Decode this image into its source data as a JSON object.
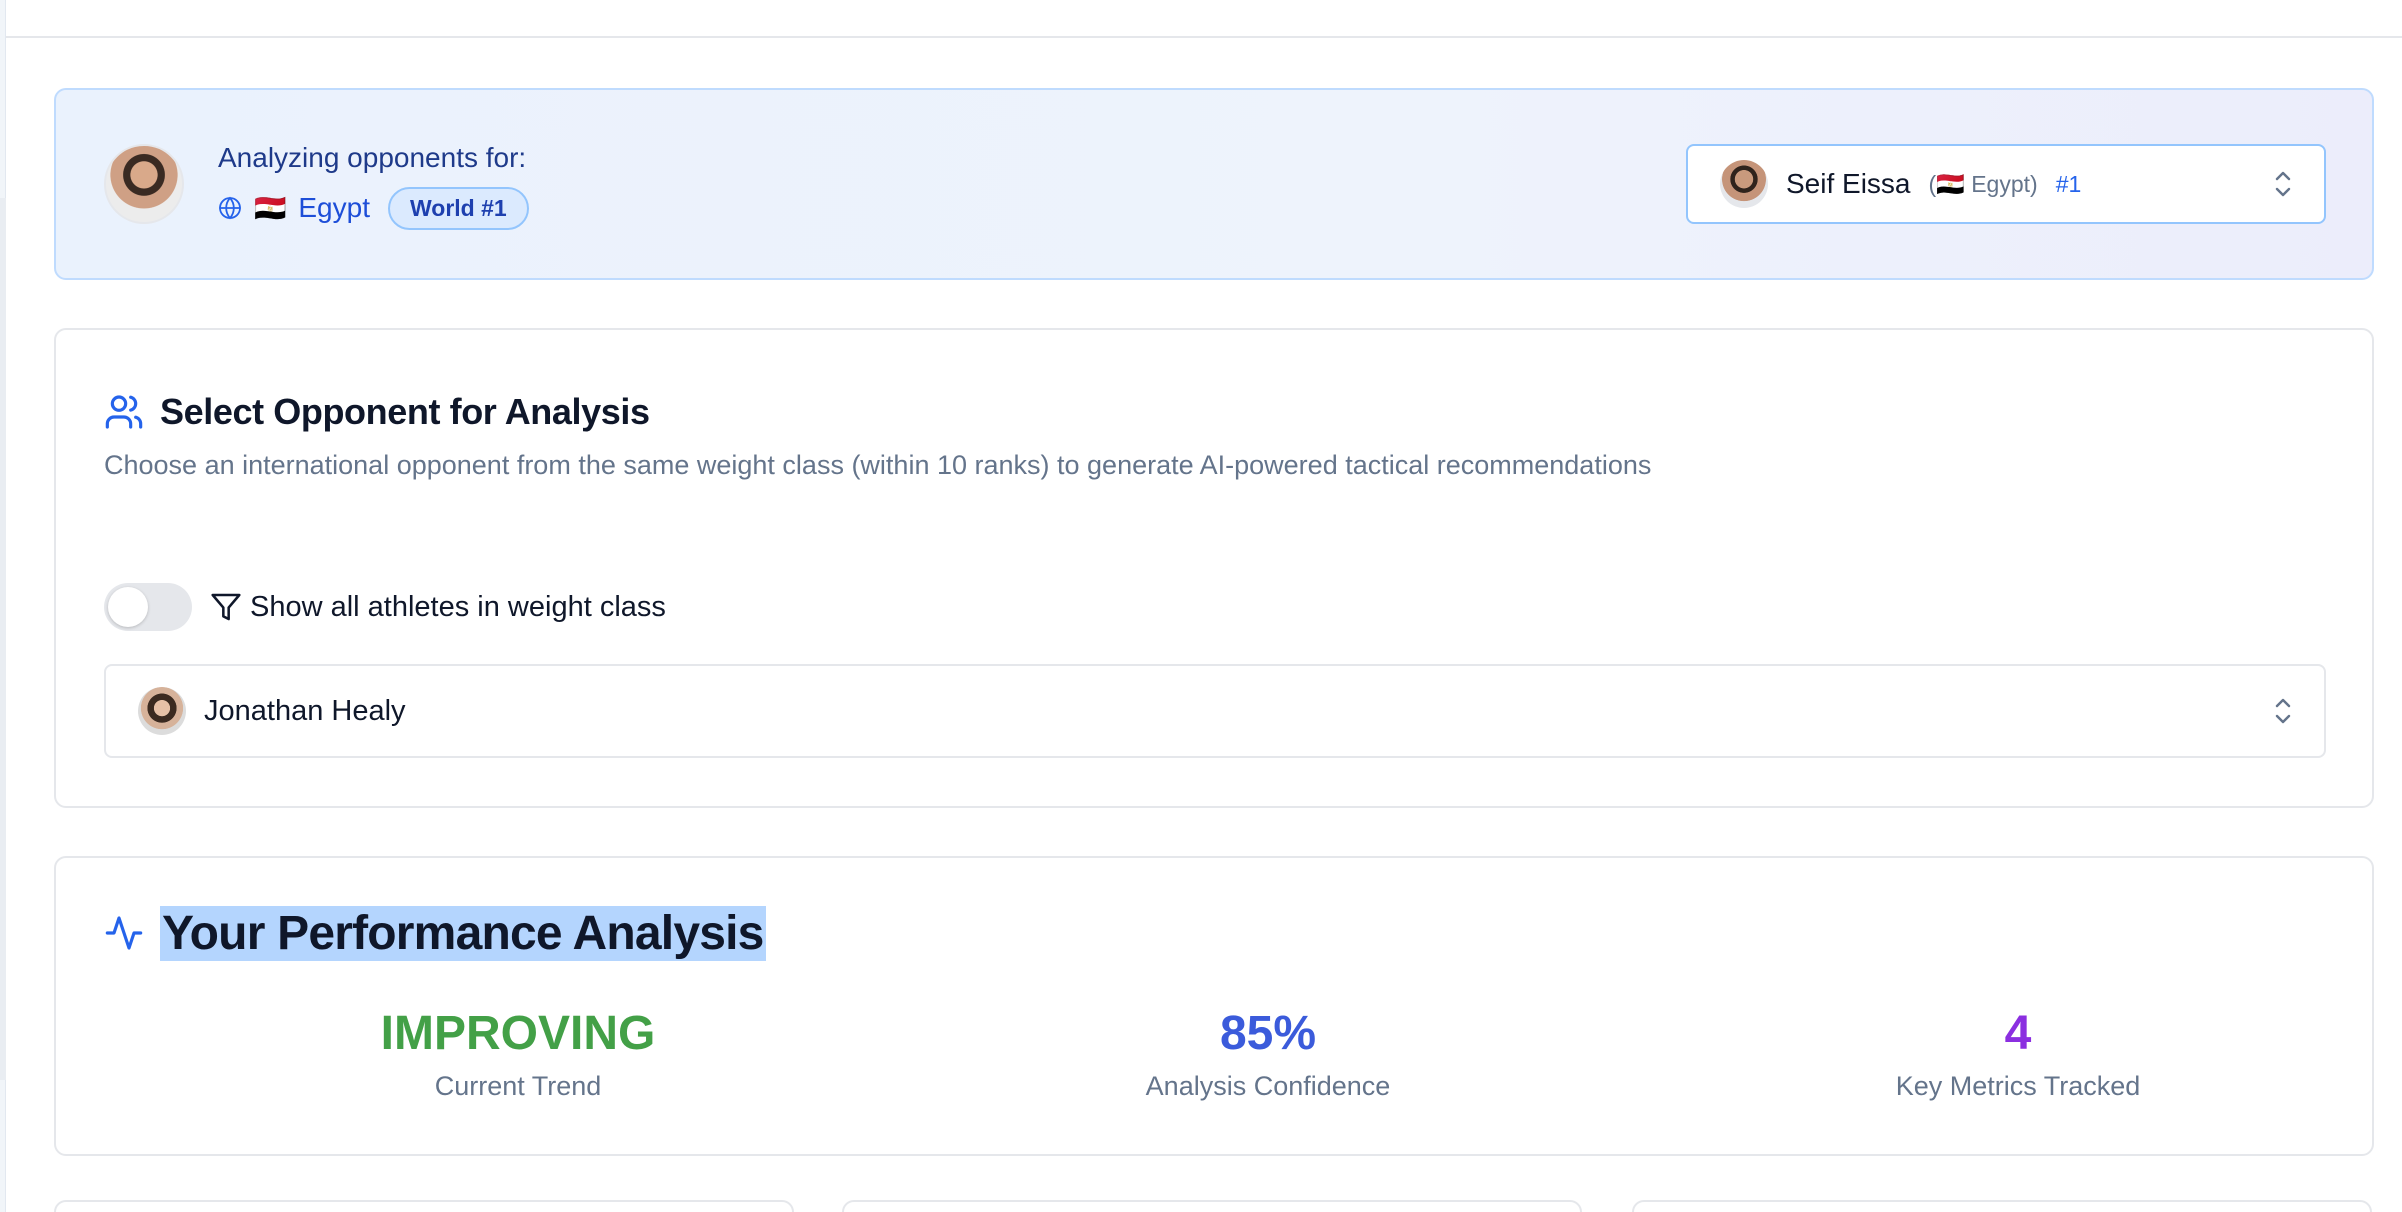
{
  "banner": {
    "label": "Analyzing opponents for:",
    "country_flag": "🇪🇬",
    "country": "Egypt",
    "world_rank_badge": "World #1",
    "selector": {
      "name": "Seif Eissa",
      "country_open": "(",
      "country_flag": "🇪🇬",
      "country": "Egypt",
      "country_close": ")",
      "rank": "#1"
    }
  },
  "opponent_card": {
    "title": "Select Opponent for Analysis",
    "description": "Choose an international opponent from the same weight class (within 10 ranks) to generate AI-powered tactical recommendations",
    "toggle_label": "Show all athletes in weight class",
    "toggle_on": false,
    "selected_opponent": "Jonathan Healy"
  },
  "performance_card": {
    "title": "Your Performance Analysis",
    "metrics": [
      {
        "value": "IMPROVING",
        "label": "Current Trend",
        "color": "#43a047"
      },
      {
        "value": "85%",
        "label": "Analysis Confidence",
        "color": "#3b5bdb"
      },
      {
        "value": "4",
        "label": "Key Metrics Tracked",
        "color": "#8b2fe0"
      }
    ]
  },
  "colors": {
    "accent_blue": "#2563eb",
    "banner_bg": "#eaf2fd",
    "highlight": "#b4d5fe"
  },
  "icons": {
    "banner_country": "globe-icon",
    "opponent_title": "users-icon",
    "toggle": "filter-icon",
    "performance_title": "activity-icon",
    "selectors": "chevrons-up-down-icon"
  }
}
